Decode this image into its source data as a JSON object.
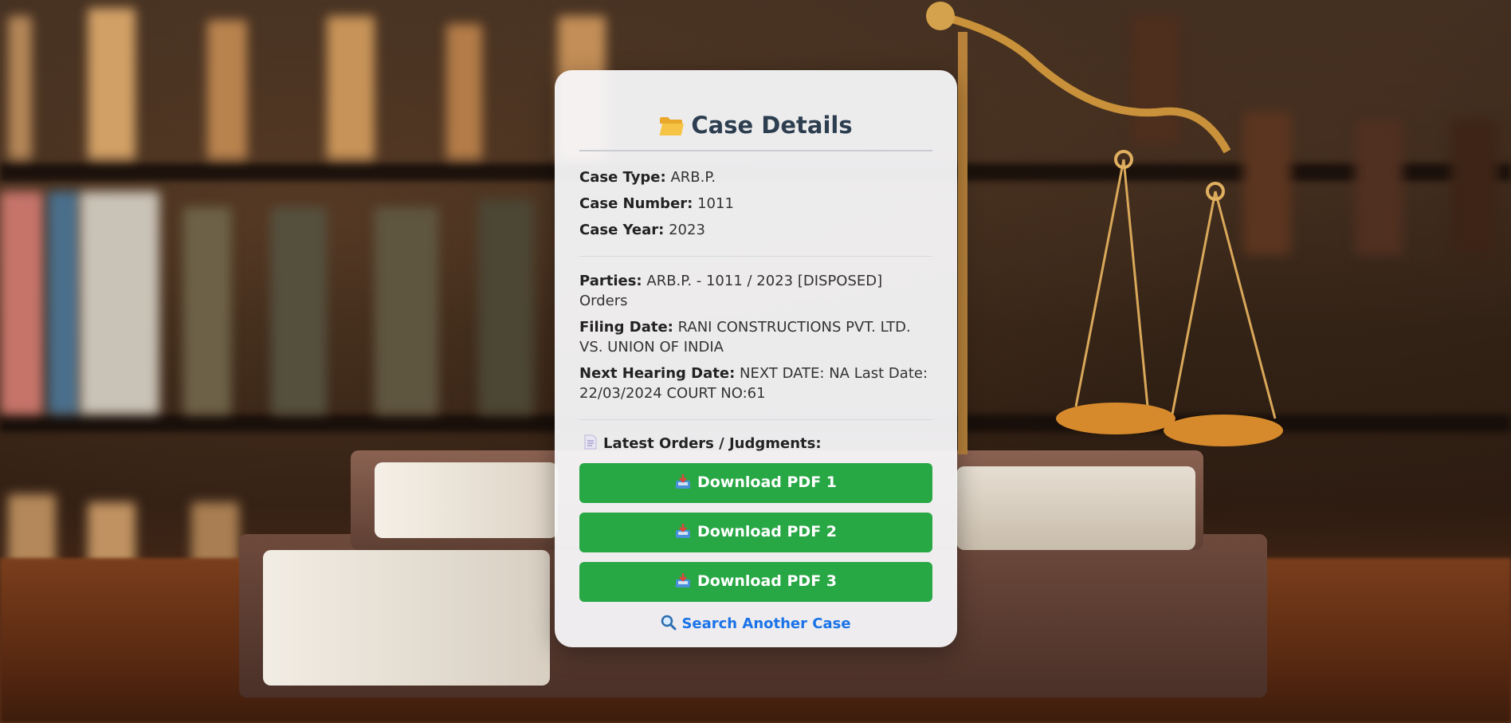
{
  "card": {
    "title": "Case Details",
    "fields": [
      {
        "label": "Case Type:",
        "value": "ARB.P."
      },
      {
        "label": "Case Number:",
        "value": "1011"
      },
      {
        "label": "Case Year:",
        "value": "2023"
      }
    ],
    "details": [
      {
        "label": "Parties:",
        "value": "ARB.P. - 1011 / 2023 [DISPOSED] Orders"
      },
      {
        "label": "Filing Date:",
        "value": "RANI CONSTRUCTIONS PVT. LTD. VS. UNION OF INDIA"
      },
      {
        "label": "Next Hearing Date:",
        "value": "NEXT DATE: NA Last Date: 22/03/2024 COURT NO:61"
      }
    ],
    "orders_heading": "Latest Orders / Judgments:",
    "downloads": [
      "Download PDF 1",
      "Download PDF 2",
      "Download PDF 3"
    ],
    "search_link": "Search Another Case"
  },
  "icons": {
    "title": "folder-icon",
    "orders": "document-icon",
    "download": "inbox-tray-icon",
    "search": "magnifier-icon"
  },
  "colors": {
    "accent_button": "#28a745",
    "link": "#1a73e8",
    "title": "#2c3e50"
  }
}
